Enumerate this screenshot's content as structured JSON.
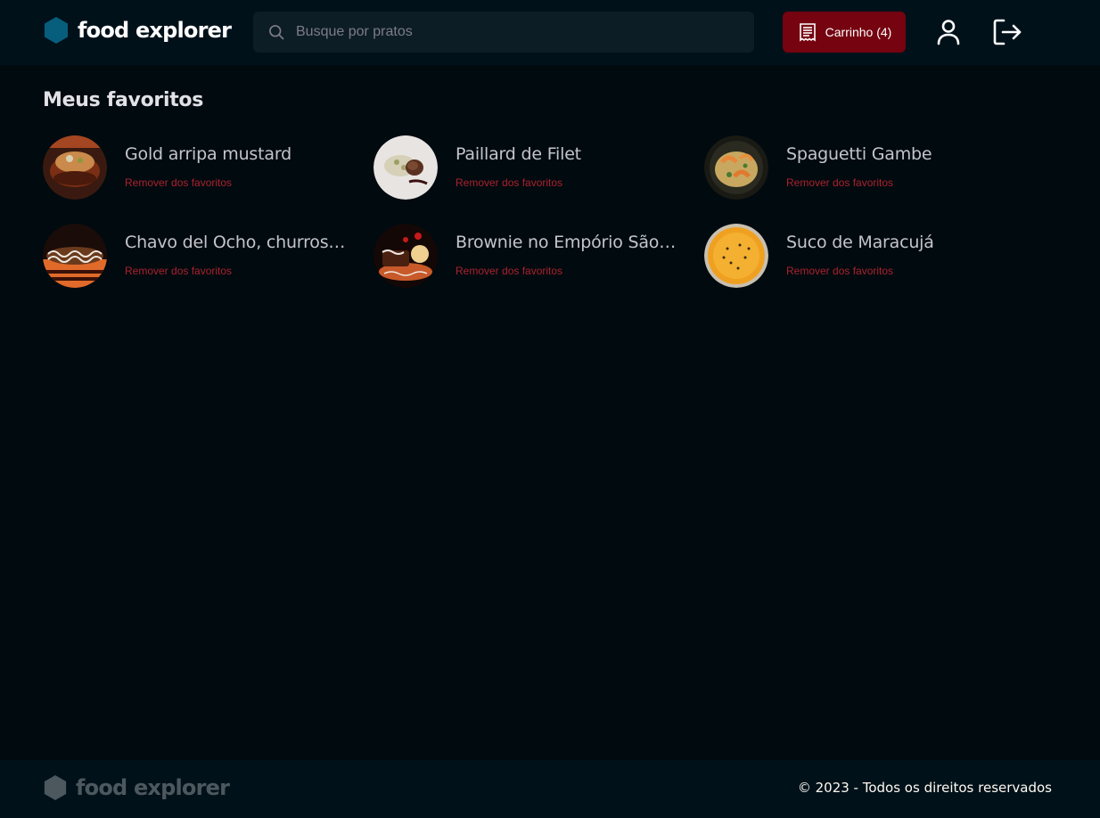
{
  "header": {
    "brand": "food explorer",
    "search_placeholder": "Busque por pratos",
    "cart_label": "Carrinho (4)"
  },
  "main": {
    "title": "Meus favoritos",
    "favorites": [
      {
        "name": "Gold arripa mustard",
        "remove_label": "Remover dos favoritos",
        "image": "burger-dish"
      },
      {
        "name": "Paillard de Filet",
        "remove_label": "Remover dos favoritos",
        "image": "filet-dish"
      },
      {
        "name": "Spaguetti Gambe",
        "remove_label": "Remover dos favoritos",
        "image": "shrimp-pasta-dish"
      },
      {
        "name": "Chavo del Ocho, churros…",
        "remove_label": "Remover dos favoritos",
        "image": "churros-dish"
      },
      {
        "name": "Brownie no Empório São…",
        "remove_label": "Remover dos favoritos",
        "image": "brownie-dish"
      },
      {
        "name": "Suco de Maracujá",
        "remove_label": "Remover dos favoritos",
        "image": "passion-fruit-juice"
      }
    ]
  },
  "footer": {
    "brand": "food explorer",
    "copyright": "© 2023 - Todos os direitos reservados"
  },
  "colors": {
    "background": "#000A0F",
    "header_bg": "#00111A",
    "accent_red": "#750310",
    "remove_text": "#AB222E",
    "logo_blue": "#065E7C"
  }
}
